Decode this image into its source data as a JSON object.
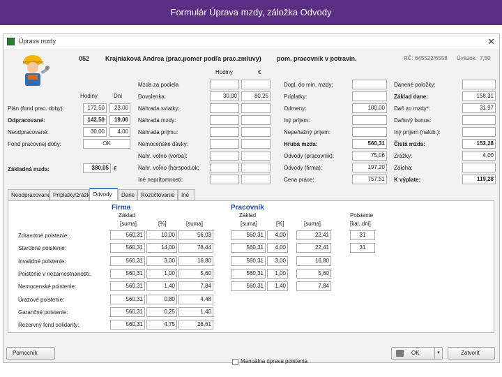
{
  "banner": {
    "title": "Formulár Úprava mzdy, záložka Odvody"
  },
  "window": {
    "title": "Úprava mzdy",
    "close_glyph": "✕"
  },
  "employee": {
    "code": "052",
    "name": "Krajniaková Andrea (prac.pomer podľa prac.zmluvy)",
    "position": "pom. pracovník v potravin.",
    "rc_label": "RČ:",
    "rc_value": "645522/6558",
    "uvazok_label": "Úväzok:",
    "uvazok_value": "7,50"
  },
  "left": {
    "hodiny_label": "Hodiny",
    "dni_label": "Dni",
    "plan_label": "Plán (fond prac. doby):",
    "plan_h": "172,50",
    "plan_d": "23,00",
    "odprac_label": "Odpracované:",
    "odprac_h": "142,50",
    "odprac_d": "19,00",
    "neodprac_label": "Neodpracované:",
    "neodprac_h": "30,00",
    "neodprac_d": "4,00",
    "fond_label": "Fond pracovnej doby:",
    "fond_value": "OK",
    "zaklad_label": "Základná mzda:",
    "zaklad_value": "380,05",
    "zaklad_unit": "€"
  },
  "mid": {
    "hodiny_label": "Hodiny",
    "eur_label": "€",
    "rows": [
      {
        "label": "Mzda za podiela",
        "h": "",
        "e": ""
      },
      {
        "label": "Dovolenka:",
        "h": "30,00",
        "e": "80,25"
      },
      {
        "label": "Náhrada sviatky:",
        "h": "",
        "e": ""
      },
      {
        "label": "Náhrada mzdy:",
        "h": "",
        "e": ""
      },
      {
        "label": "Náhrada príjmu:",
        "h": "",
        "e": ""
      },
      {
        "label": "Nemocenské dávky:",
        "h": "",
        "e": ""
      },
      {
        "label": "Nahr. voľno (vorba):",
        "h": "",
        "e": ""
      },
      {
        "label": "Nahr. voľno (horspod.ok:",
        "h": "",
        "e": ""
      },
      {
        "label": "Iné neprítomnosti:",
        "h": "",
        "e": ""
      }
    ]
  },
  "right1": {
    "rows": [
      {
        "label": "Dopl. do min. mzdy:",
        "v": ""
      },
      {
        "label": "Príplatky:",
        "v": ""
      },
      {
        "label": "Odmeny:",
        "v": "100,00"
      },
      {
        "label": "Iný príjem:",
        "v": ""
      },
      {
        "label": "Nepeňažný príjem:",
        "v": ""
      },
      {
        "label": "Hrubá mzda:",
        "v": "560,31"
      },
      {
        "label": "Odvody (pracovník):",
        "v": "75,06"
      },
      {
        "label": "Odvody (firma):",
        "v": "197,20"
      },
      {
        "label": "Cena práce:",
        "v": "757,51"
      }
    ]
  },
  "right2": {
    "rows": [
      {
        "label": "Danené položky:",
        "v": ""
      },
      {
        "label": "Základ dane:",
        "v": "158,31"
      },
      {
        "label": "Daň zo mzdy*:",
        "v": "31,97"
      },
      {
        "label": "Daňový bonus:",
        "v": ""
      },
      {
        "label": "Iný príjem (nalob.):",
        "v": ""
      },
      {
        "label": "Čistá mzda:",
        "v": "153,28"
      },
      {
        "label": "Zrážky:",
        "v": "4,00"
      },
      {
        "label": "Záloha:",
        "v": ""
      },
      {
        "label": "K výplate:",
        "v": "119,28"
      }
    ]
  },
  "tabs": [
    "Neodpracované",
    "Príplatky/zrážky",
    "Odvody",
    "Dane",
    "Rozúčtovanie",
    "Iné"
  ],
  "panel": {
    "firma_title": "Firma",
    "pracovnik_title": "Pracovník",
    "col_zaklad": "Základ",
    "col_suma": "[suma]",
    "col_pct": "[%]",
    "col_poistenie": "Poistenie",
    "col_kal_dni": "[kal. dni]",
    "rows": [
      {
        "label": "Zdravotné poistenie:",
        "fz": "560,31",
        "fp": "10,00",
        "fs": "56,03",
        "pz": "560,31",
        "pp": "4,00",
        "ps": "22,41",
        "pd": "31"
      },
      {
        "label": "Starobné poistenie:",
        "fz": "560,31",
        "fp": "14,00",
        "fs": "78,44",
        "pz": "560,31",
        "pp": "4,00",
        "ps": "22,41",
        "pd": "31"
      },
      {
        "label": "Invalidné poistenie:",
        "fz": "560,31",
        "fp": "3,00",
        "fs": "16,80",
        "pz": "560,31",
        "pp": "3,00",
        "ps": "16,80",
        "pd": ""
      },
      {
        "label": "Poistenie v nezamestnanosti:",
        "fz": "560,31",
        "fp": "1,00",
        "fs": "5,60",
        "pz": "560,31",
        "pp": "1,00",
        "ps": "5,60",
        "pd": ""
      },
      {
        "label": "Nemocenské poistenie:",
        "fz": "560,31",
        "fp": "1,40",
        "fs": "7,84",
        "pz": "560,31",
        "pp": "1,40",
        "ps": "7,84",
        "pd": ""
      },
      {
        "label": "Úrazové poistenie:",
        "fz": "560,31",
        "fp": "0,80",
        "fs": "4,48",
        "pz": null,
        "pp": null,
        "ps": null,
        "pd": ""
      },
      {
        "label": "Garančné poistenie:",
        "fz": "560,31",
        "fp": "0,25",
        "fs": "1,40",
        "pz": null,
        "pp": null,
        "ps": null,
        "pd": ""
      },
      {
        "label": "Rezervný fond solidarity:",
        "fz": "560,31",
        "fp": "4,75",
        "fs": "26,61",
        "pz": null,
        "pp": null,
        "ps": null,
        "pd": ""
      }
    ],
    "manual_label": "Manuálna úprava poistenia"
  },
  "buttons": {
    "help": "Pomocník",
    "ok": "OK",
    "close": "Zatvoriť"
  }
}
